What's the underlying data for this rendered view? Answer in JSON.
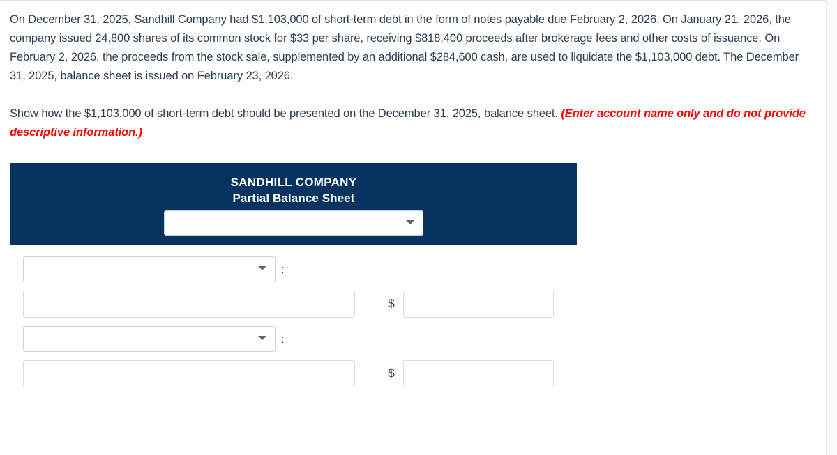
{
  "problem": {
    "paragraph_1": "On December 31, 2025, Sandhill Company had $1,103,000 of short-term debt in the form of notes payable due February 2, 2026. On January 21, 2026, the company issued 24,800 shares of its common stock for $33 per share, receiving $818,400 proceeds after brokerage fees and other costs of issuance. On February 2, 2026, the proceeds from the stock sale, supplemented by an additional $284,600 cash, are used to liquidate the $1,103,000 debt. The December 31, 2025, balance sheet is issued on February 23, 2026.",
    "paragraph_2_plain": "Show how the $1,103,000 of short-term debt should be presented on the December 31, 2025, balance sheet. ",
    "paragraph_2_emphasis": "(Enter account name only and do not provide descriptive information.)"
  },
  "statement": {
    "header": {
      "company_name": "SANDHILL COMPANY",
      "report_title": "Partial Balance Sheet",
      "background_color": "#06335f",
      "text_color": "#ffffff",
      "date_select": {
        "value": "",
        "placeholder": "",
        "icon": "chevron-down-icon"
      }
    },
    "rows": [
      {
        "kind": "section-select",
        "select_value": "",
        "select_icon": "chevron-down-icon",
        "separator": ":"
      },
      {
        "kind": "account-amount",
        "account_value": "",
        "currency_symbol": "$",
        "amount_value": ""
      },
      {
        "kind": "section-select",
        "select_value": "",
        "select_icon": "chevron-down-icon",
        "separator": ":"
      },
      {
        "kind": "account-amount",
        "account_value": "",
        "currency_symbol": "$",
        "amount_value": ""
      }
    ]
  },
  "theme": {
    "body_text_color": "#2d3e50",
    "emphasis_color": "#ff0000",
    "navy": "#06335f",
    "input_border": "#d8dcdf"
  }
}
